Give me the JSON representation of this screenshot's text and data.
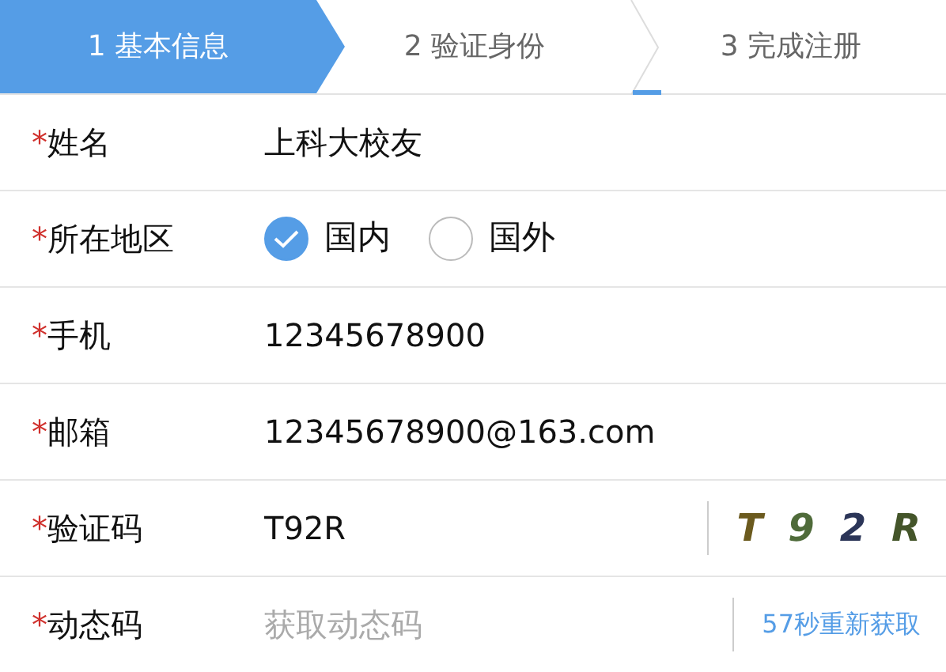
{
  "steps": [
    {
      "number": "1",
      "label": "基本信息",
      "selected": true
    },
    {
      "number": "2",
      "label": "验证身份",
      "selected": false
    },
    {
      "number": "3",
      "label": "完成注册",
      "selected": false
    }
  ],
  "form": [
    {
      "kind": "text",
      "required": "*",
      "label": "姓名",
      "value": "上科大校友"
    },
    {
      "kind": "radio",
      "required": "*",
      "label": "所在地区",
      "options": [
        {
          "label": "国内",
          "selected": true
        },
        {
          "label": "国外",
          "selected": false
        }
      ]
    },
    {
      "kind": "text",
      "required": "*",
      "label": "手机",
      "value": "12345678900"
    },
    {
      "kind": "text",
      "required": "*",
      "label": "邮箱",
      "value": "12345678900@163.com"
    },
    {
      "kind": "captcha",
      "required": "*",
      "label": "验证码",
      "value": "T92R",
      "captcha": [
        {
          "char": "T",
          "color": "#6b5a1e"
        },
        {
          "char": "9",
          "color": "#4f6b3a"
        },
        {
          "char": "2",
          "color": "#2b3558"
        },
        {
          "char": "R",
          "color": "#44552a"
        }
      ]
    },
    {
      "kind": "sms",
      "required": "*",
      "label": "动态码",
      "placeholder": "获取动态码",
      "action": "57秒重新获取"
    }
  ]
}
